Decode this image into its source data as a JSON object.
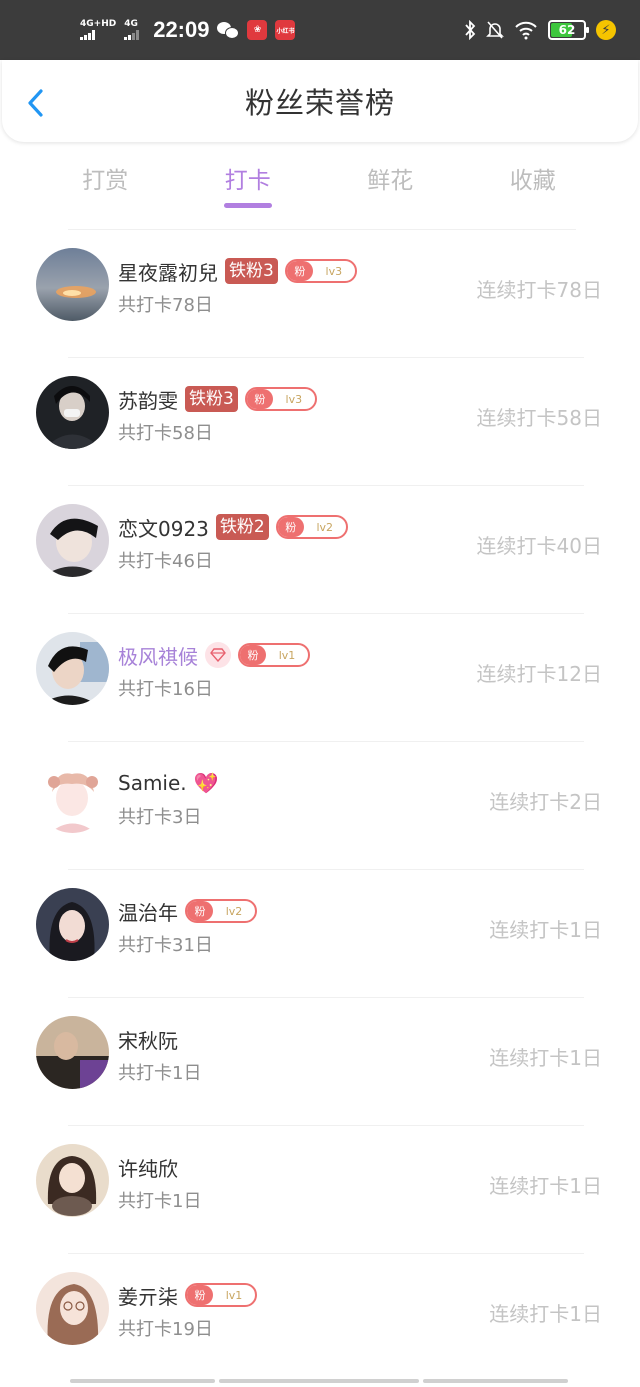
{
  "status_bar": {
    "sim1_label": "4G+HD",
    "sim2_label": "4G",
    "time": "22:09",
    "app_icon_1": "小红书",
    "battery_level": "62",
    "icons": [
      "signal-icon",
      "wechat-icon",
      "app-icon",
      "bluetooth-icon",
      "mute-icon",
      "wifi-icon",
      "battery-icon",
      "charging-icon"
    ]
  },
  "header": {
    "title": "粉丝荣誉榜",
    "back_icon": "chevron-left-icon"
  },
  "tabs": [
    {
      "label": "打赏",
      "active": false
    },
    {
      "label": "打卡",
      "active": true
    },
    {
      "label": "鲜花",
      "active": false
    },
    {
      "label": "收藏",
      "active": false
    }
  ],
  "colors": {
    "accent": "#b17fe0",
    "back": "#2196f3",
    "iron_badge": "#c95a54",
    "fan_badge": "#ee7070"
  },
  "fans": [
    {
      "name": "星夜露初兒",
      "iron": "铁粉3",
      "fan_prefix": "粉",
      "level": "lv3",
      "total": "共打卡78日",
      "streak": "连续打卡78日"
    },
    {
      "name": "苏韵雯",
      "iron": "铁粉3",
      "fan_prefix": "粉",
      "level": "lv3",
      "total": "共打卡58日",
      "streak": "连续打卡58日"
    },
    {
      "name": "恋文0923",
      "iron": "铁粉2",
      "fan_prefix": "粉",
      "level": "lv2",
      "total": "共打卡46日",
      "streak": "连续打卡40日"
    },
    {
      "name": "极风祺候",
      "fan_prefix": "粉",
      "level": "lv1",
      "total": "共打卡16日",
      "streak": "连续打卡12日"
    },
    {
      "name": "Samie.",
      "total": "共打卡3日",
      "streak": "连续打卡2日"
    },
    {
      "name": "温治年",
      "fan_prefix": "粉",
      "level": "lv2",
      "total": "共打卡31日",
      "streak": "连续打卡1日"
    },
    {
      "name": "宋秋阮",
      "total": "共打卡1日",
      "streak": "连续打卡1日"
    },
    {
      "name": "许纯欣",
      "total": "共打卡1日",
      "streak": "连续打卡1日"
    },
    {
      "name": "姜亓柒",
      "fan_prefix": "粉",
      "level": "lv1",
      "total": "共打卡19日",
      "streak": "连续打卡1日"
    }
  ]
}
